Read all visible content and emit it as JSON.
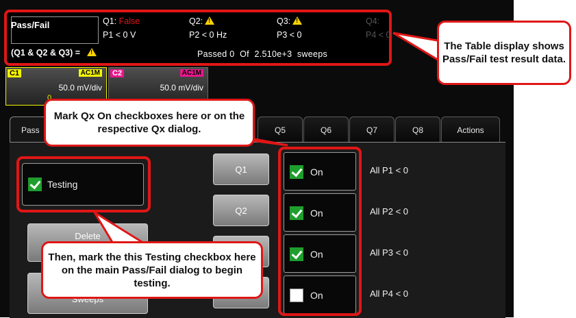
{
  "pass_fail_table": {
    "title": "Pass/Fail",
    "summary_expression": "(Q1 & Q2 & Q3) =",
    "passed_label": "Passed",
    "passed_value": "0",
    "of_label": "Of",
    "sweeps_value": "2.510e+3",
    "sweeps_label": "sweeps",
    "queries": [
      {
        "name": "Q1:",
        "state": "False",
        "condition": "P1 < 0 V"
      },
      {
        "name": "Q2:",
        "state": "warning",
        "condition": "P2 < 0 Hz"
      },
      {
        "name": "Q3:",
        "state": "warning",
        "condition": "P3 < 0"
      },
      {
        "name": "Q4:",
        "state": "",
        "condition": "P4 < 0"
      }
    ]
  },
  "channels": [
    {
      "tag": "C1",
      "coupling": "AC1M",
      "scale": "50.0 mV/div",
      "offset": "0",
      "color": "#f4f400"
    },
    {
      "tag": "C2",
      "coupling": "AC1M",
      "scale": "50.0 mV/div",
      "color": "#e8168c"
    }
  ],
  "tabs": [
    "Pass",
    "Q5",
    "Q6",
    "Q7",
    "Q8",
    "Actions"
  ],
  "testing": {
    "label": "Testing",
    "checked": true
  },
  "buttons": {
    "delete": "Delete",
    "sweeps": "Sweeps"
  },
  "query_rows": [
    {
      "button": "Q1",
      "on_label": "On",
      "checked": true,
      "description": "All P1 < 0"
    },
    {
      "button": "Q2",
      "on_label": "On",
      "checked": true,
      "description": "All P2 < 0"
    },
    {
      "button": "",
      "on_label": "On",
      "checked": true,
      "description": "All P3 < 0"
    },
    {
      "button": "",
      "on_label": "On",
      "checked": false,
      "description": "All P4 < 0"
    }
  ],
  "callouts": {
    "table": "The Table display shows Pass/Fail test result data.",
    "mark_qx": "Mark Qx On checkboxes here or on the respective Qx dialog.",
    "testing": "Then, mark the this Testing checkbox here on the main Pass/Fail dialog to begin testing."
  },
  "colors": {
    "highlight": "#e01616",
    "false_text": "#e01616",
    "warning": "#ffd400",
    "check": "#1f9e2e"
  }
}
